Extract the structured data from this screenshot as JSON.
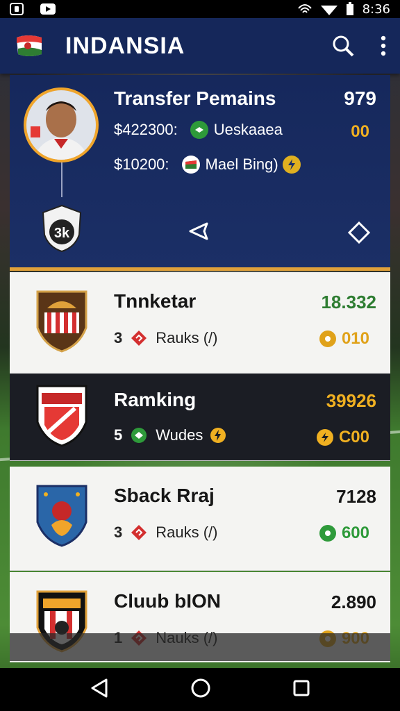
{
  "status_bar": {
    "time": "8:36"
  },
  "header": {
    "title": "INDANSIA"
  },
  "feature": {
    "title": "Transfer Pemains",
    "count": "979",
    "row1_amount": "$422300:",
    "row1_name": "Ueskaaea",
    "row1_value": "00",
    "row2_amount": "$10200:",
    "row2_name": "Mael Bing)",
    "badge_text": "3k"
  },
  "teams": [
    {
      "name": "Tnnketar",
      "score": "18.332",
      "num": "3",
      "label": "Rauks (/)",
      "stat": "010",
      "score_color": "#2e7d32",
      "stat_color": "#e0a21a"
    },
    {
      "name": "Ramking",
      "score": "39926",
      "num": "5",
      "label": "Wudes",
      "stat": "C00",
      "score_color": "#f0b021",
      "stat_color": "#f0b021"
    },
    {
      "name": "Sback Rraj",
      "score": "7128",
      "num": "3",
      "label": "Rauks (/)",
      "stat": "600",
      "score_color": "#161616",
      "stat_color": "#2e9a3a"
    },
    {
      "name": "Cluub bION",
      "score": "2.890",
      "num": "1",
      "label": "Nauks (/)",
      "stat": "900",
      "score_color": "#161616",
      "stat_color": "#e0a21a"
    }
  ],
  "colors": {
    "header": "#15275a",
    "accent": "#f0a52b",
    "dark_card": "#1b1d24"
  }
}
